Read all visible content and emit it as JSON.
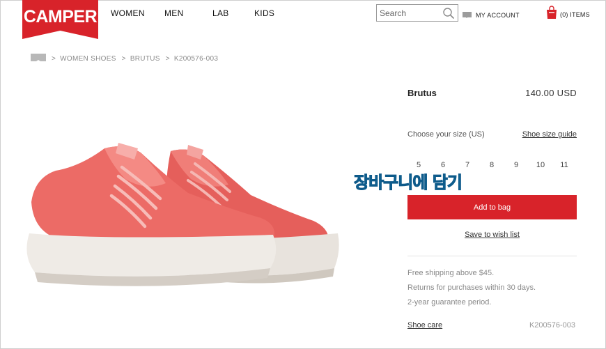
{
  "brand": {
    "logo_text": "CAMPER",
    "color": "#d8232a"
  },
  "nav": {
    "items": [
      "WOMEN",
      "MEN",
      "LAB",
      "KIDS"
    ]
  },
  "search": {
    "placeholder": "Search",
    "icon": "search-icon"
  },
  "account": {
    "label": "MY ACCOUNT",
    "icon": "user-card-icon"
  },
  "cart": {
    "label": "(0) ITEMS",
    "icon": "shopping-bag-icon"
  },
  "breadcrumb": {
    "home_icon": "home-icon",
    "separator": ">",
    "items": [
      "WOMEN SHOES",
      "BRUTUS",
      "K200576-003"
    ]
  },
  "product": {
    "name": "Brutus",
    "price": "140.00  USD",
    "size_label": "Choose your size (US)",
    "size_guide": "Shoe size guide",
    "sizes": [
      "5",
      "6",
      "7",
      "8",
      "9",
      "10",
      "11"
    ],
    "overlay": "장바구니에 담기",
    "add_to_bag": "Add to bag",
    "wish_list": "Save to wish list",
    "info": [
      "Free shipping above $45.",
      "Returns for purchases within 30 days.",
      "2-year guarantee period."
    ],
    "shoe_care": "Shoe care",
    "reference": "K200576-003",
    "shoe_color": "#ec6b66",
    "button_color": "#d8232a"
  }
}
